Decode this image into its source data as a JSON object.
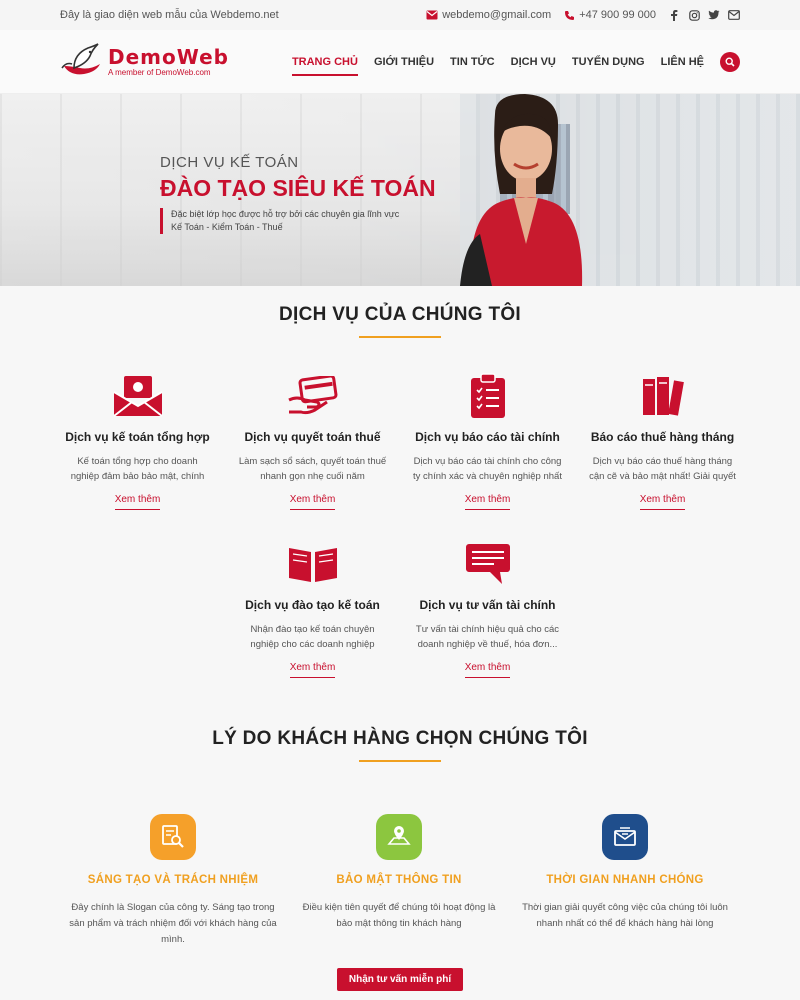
{
  "topbar": {
    "tagline": "Đây là giao diện web mẫu của Webdemo.net",
    "email": "webdemo@gmail.com",
    "phone": "+47 900 99 000",
    "socials": [
      "facebook-icon",
      "instagram-icon",
      "twitter-icon",
      "mail-icon"
    ]
  },
  "header": {
    "logo_name": "DemoWeb",
    "logo_sub": "A member of DemoWeb.com",
    "nav": [
      "TRANG CHỦ",
      "GIỚI THIỆU",
      "TIN TỨC",
      "DỊCH VỤ",
      "TUYỂN DỤNG",
      "LIÊN HỆ"
    ],
    "active_nav": "TRANG CHỦ"
  },
  "hero": {
    "kicker": "DỊCH VỤ KẾ TOÁN",
    "title": "ĐÀO TẠO SIÊU KẾ TOÁN",
    "desc_line1": "Đặc biệt lớp học được hỗ trợ bởi các chuyên gia lĩnh vực",
    "desc_line2": "Kế Toán - Kiểm Toán - Thuế"
  },
  "services": {
    "title": "DỊCH VỤ CỦA CHÚNG TÔI",
    "items": [
      {
        "icon": "money-envelope-icon",
        "title": "Dịch vụ kế toán tổng hợp",
        "desc": "Kế toán tổng hợp cho doanh nghiệp đảm bảo bảo mật, chính xác",
        "more": "Xem thêm"
      },
      {
        "icon": "card-hand-icon",
        "title": "Dịch vụ quyết toán thuế",
        "desc": "Làm sạch sổ sách, quyết toán thuế nhanh gọn nhẹ cuối năm",
        "more": "Xem thêm"
      },
      {
        "icon": "clipboard-icon",
        "title": "Dịch vụ báo cáo tài chính",
        "desc": "Dịch vụ báo cáo tài chính cho công ty chính xác và chuyên nghiệp nhất",
        "more": "Xem thêm"
      },
      {
        "icon": "books-icon",
        "title": "Báo cáo thuế hàng tháng",
        "desc": "Dịch vụ báo cáo thuế hàng tháng cận cẽ và bảo mật nhất! Giải quyết nỗi lo...",
        "more": "Xem thêm"
      },
      {
        "icon": "open-book-icon",
        "title": "Dịch vụ đào tạo kế toán",
        "desc": "Nhận đào tạo kế toán chuyên nghiệp cho các doanh nghiệp",
        "more": "Xem thêm"
      },
      {
        "icon": "chat-icon",
        "title": "Dịch vụ tư vấn tài chính",
        "desc": "Tư vấn tài chính hiệu quả cho các doanh nghiệp về thuế, hóa đơn...",
        "more": "Xem thêm"
      }
    ]
  },
  "reasons": {
    "title": "LÝ DO KHÁCH HÀNG CHỌN CHÚNG TÔI",
    "items": [
      {
        "icon": "search-document-icon",
        "color": "#f5a02a",
        "title": "SÁNG TẠO VÀ TRÁCH NHIỆM",
        "desc": "Đây chính là Slogan của công ty. Sáng tạo trong sản phẩm và trách nhiệm đối với khách hàng của mình."
      },
      {
        "icon": "map-pin-icon",
        "color": "#8cc63f",
        "title": "BẢO MẬT THÔNG TIN",
        "desc": "Điều kiện tiên quyết để chúng tôi hoạt động là bảo mật thông tin khách hàng"
      },
      {
        "icon": "envelope-icon",
        "color": "#1f4e8c",
        "title": "THỜI GIAN NHANH CHÓNG",
        "desc": "Thời gian giải quyết công việc của chúng tôi luôn nhanh nhất có thể để khách hàng hài lòng"
      }
    ],
    "cta": "Nhận tư vấn miễn phí"
  },
  "colors": {
    "brand": "#c8102e",
    "accent": "#f0a020"
  }
}
